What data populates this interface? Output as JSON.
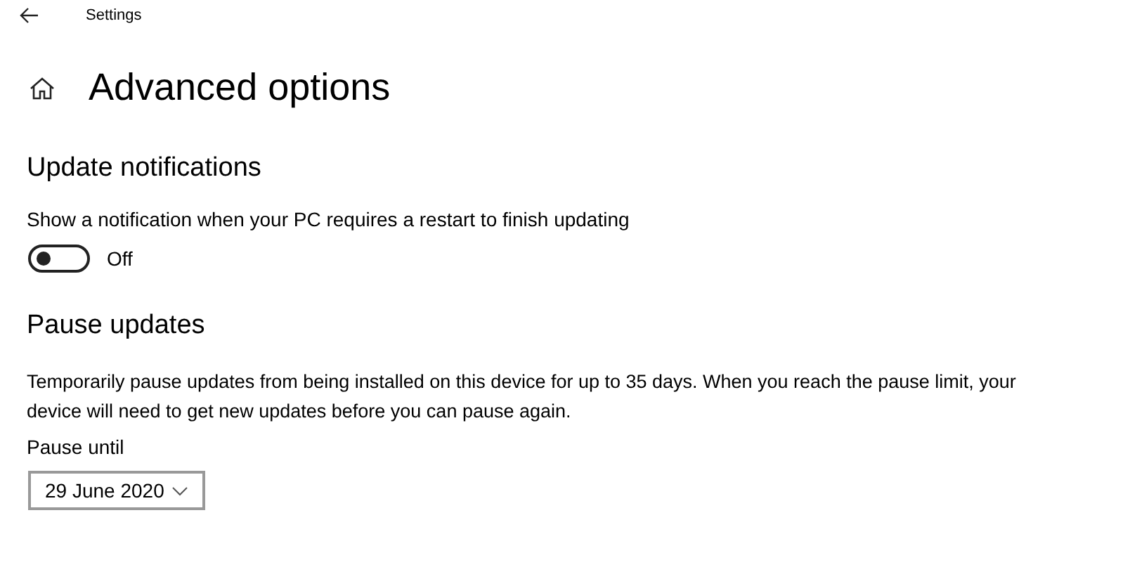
{
  "window": {
    "title": "Settings"
  },
  "page": {
    "title": "Advanced options"
  },
  "update_notifications": {
    "heading": "Update notifications",
    "label": "Show a notification when your PC requires a restart to finish updating",
    "toggle": {
      "on": false,
      "state_text": "Off"
    }
  },
  "pause_updates": {
    "heading": "Pause updates",
    "description_lines": [
      "Temporarily pause updates from being installed on this device for up to 35 days. When you reach the pause limit, your",
      "device will need to get new updates before you can pause again."
    ],
    "field_label": "Pause until",
    "dropdown": {
      "value": "29 June 2020"
    }
  }
}
